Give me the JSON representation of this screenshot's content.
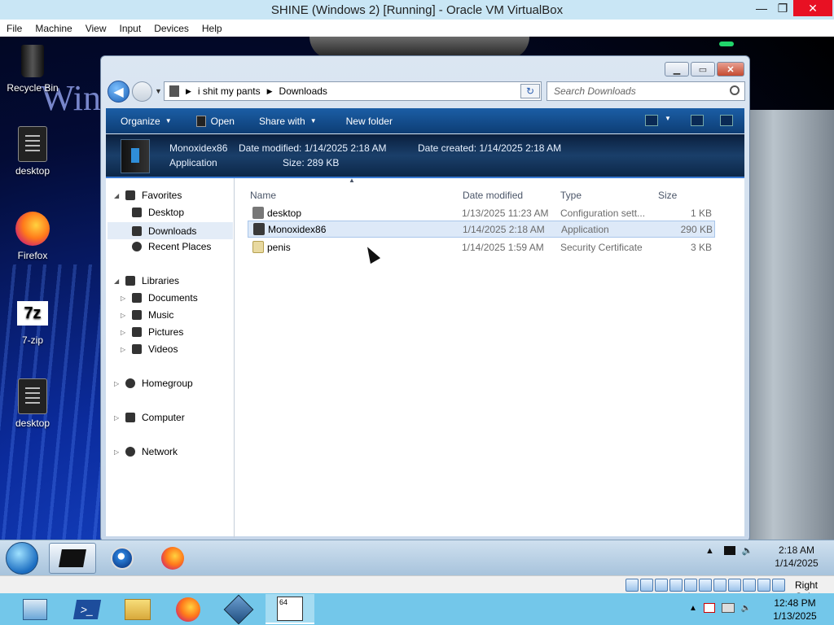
{
  "vbox": {
    "title": "SHINE (Windows 2) [Running] - Oracle VM VirtualBox",
    "menu": [
      "File",
      "Machine",
      "View",
      "Input",
      "Devices",
      "Help"
    ],
    "host_key": "Right Ctrl"
  },
  "desktop": {
    "icons": [
      {
        "label": "Recycle Bin",
        "icon": "recycle-bin-icon"
      },
      {
        "label": "desktop",
        "icon": "document-icon"
      },
      {
        "label": "Firefox",
        "icon": "firefox-icon"
      },
      {
        "label": "7-zip",
        "icon": "7zip-icon"
      },
      {
        "label": "desktop",
        "icon": "document-icon"
      }
    ],
    "zip_glyph": "7z",
    "wallpaper_text": "Wind"
  },
  "explorer": {
    "breadcrumb": [
      "i shit my pants",
      "Downloads"
    ],
    "search_placeholder": "Search Downloads",
    "toolbar": {
      "organize": "Organize",
      "open": "Open",
      "share_with": "Share with",
      "new_folder": "New folder"
    },
    "details": {
      "name": "Monoxidex86",
      "type": "Application",
      "date_modified": "Date modified: 1/14/2025 2:18 AM",
      "date_created": "Date created: 1/14/2025 2:18 AM",
      "size": "Size: 289 KB"
    },
    "nav": {
      "favorites": "Favorites",
      "desktop": "Desktop",
      "downloads": "Downloads",
      "recent": "Recent Places",
      "libraries": "Libraries",
      "documents": "Documents",
      "music": "Music",
      "pictures": "Pictures",
      "videos": "Videos",
      "homegroup": "Homegroup",
      "computer": "Computer",
      "network": "Network"
    },
    "columns": {
      "name": "Name",
      "date": "Date modified",
      "type": "Type",
      "size": "Size"
    },
    "files": [
      {
        "name": "desktop",
        "date": "1/13/2025 11:23 AM",
        "type": "Configuration sett...",
        "size": "1 KB"
      },
      {
        "name": "Monoxidex86",
        "date": "1/14/2025 2:18 AM",
        "type": "Application",
        "size": "290 KB"
      },
      {
        "name": "penis",
        "date": "1/14/2025 1:59 AM",
        "type": "Security Certificate",
        "size": "3 KB"
      }
    ]
  },
  "guest_taskbar": {
    "time": "2:18 AM",
    "date": "1/14/2025"
  },
  "host_taskbar": {
    "time": "12:48 PM",
    "date": "1/13/2025",
    "vbox_badge": "64"
  }
}
